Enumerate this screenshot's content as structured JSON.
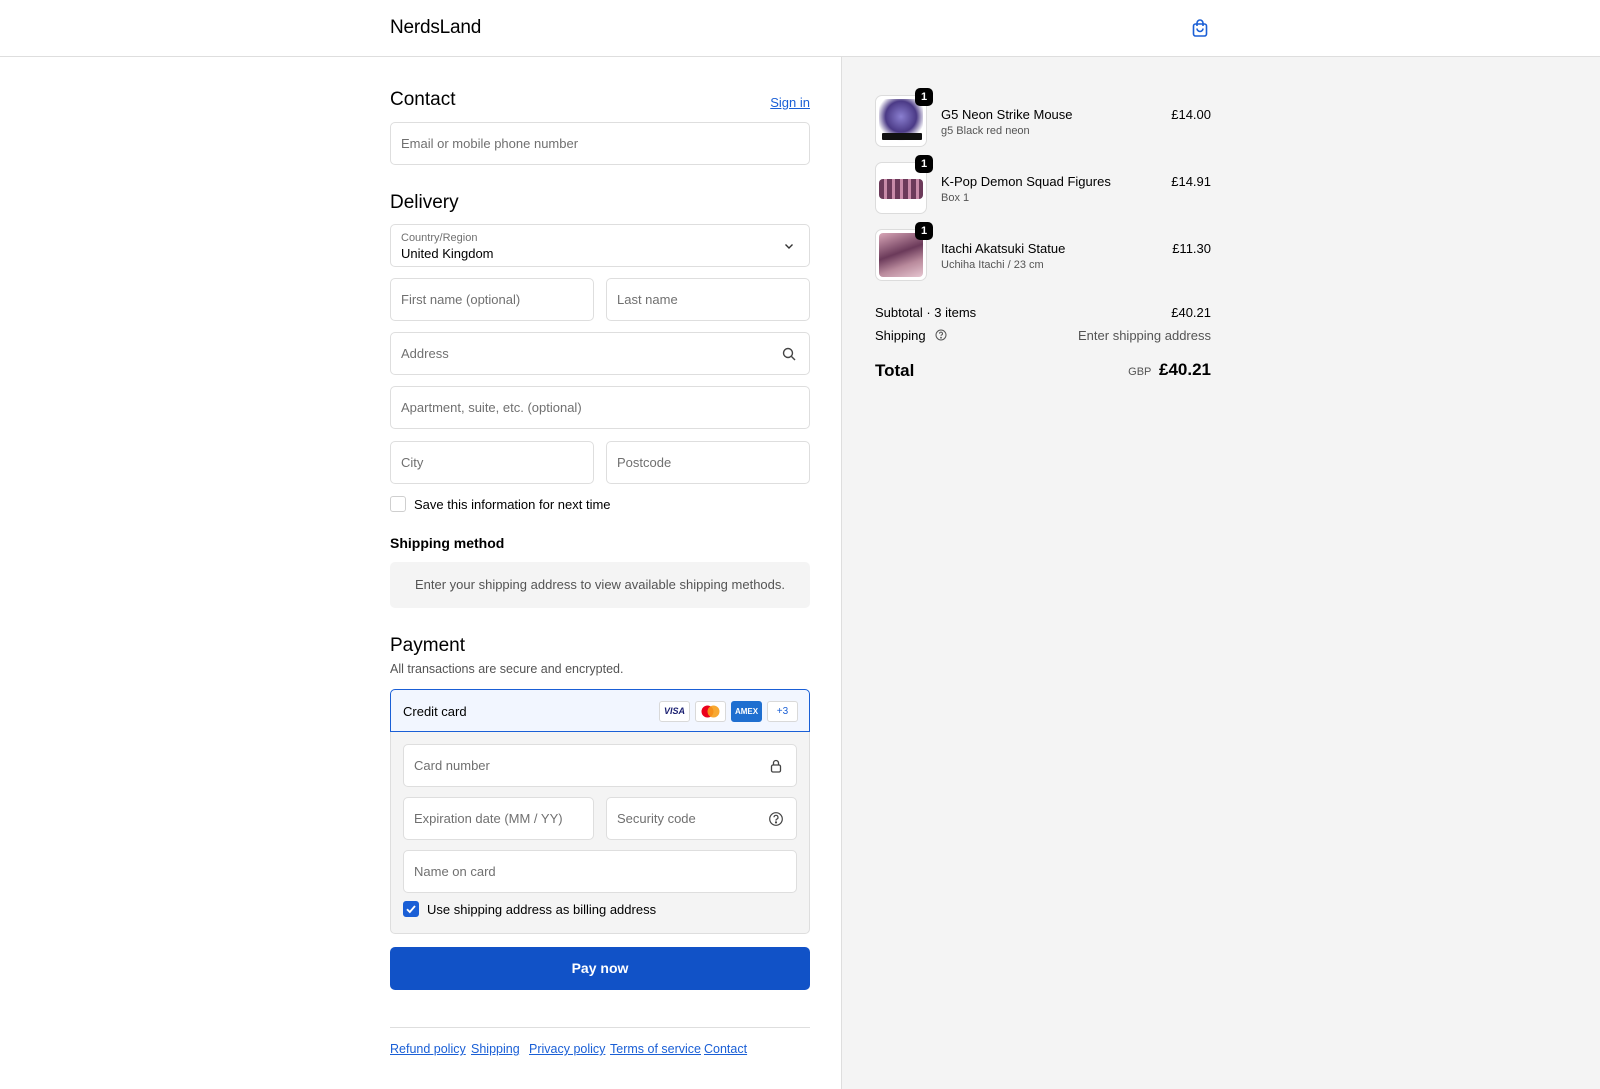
{
  "header": {
    "brand": "NerdsLand",
    "cart_icon": "shopping-bag-icon"
  },
  "contact": {
    "title": "Contact",
    "sign_in": "Sign in",
    "email_placeholder": "Email or mobile phone number"
  },
  "delivery": {
    "title": "Delivery",
    "country_label": "Country/Region",
    "country_value": "United Kingdom",
    "first_name_placeholder": "First name (optional)",
    "last_name_placeholder": "Last name",
    "address_placeholder": "Address",
    "apartment_placeholder": "Apartment, suite, etc. (optional)",
    "city_placeholder": "City",
    "postcode_placeholder": "Postcode",
    "save_info_label": "Save this information for next time",
    "save_info_checked": false
  },
  "shipping_method": {
    "title": "Shipping method",
    "message": "Enter your shipping address to view available shipping methods."
  },
  "payment": {
    "title": "Payment",
    "subtitle": "All transactions are secure and encrypted.",
    "method_label": "Credit card",
    "card_logos": [
      "VISA",
      "Mastercard",
      "AMEX",
      "+3"
    ],
    "card_number_placeholder": "Card number",
    "expiry_placeholder": "Expiration date (MM / YY)",
    "security_placeholder": "Security code",
    "name_placeholder": "Name on card",
    "billing_same_label": "Use shipping address as billing address",
    "billing_same_checked": true,
    "pay_button": "Pay now"
  },
  "footer": {
    "links": [
      "Refund policy",
      "Shipping",
      "Privacy policy",
      "Terms of service",
      "Contact"
    ]
  },
  "order": {
    "items": [
      {
        "name": "G5 Neon Strike Mouse",
        "variant": "g5 Black red neon",
        "price": "£14.00",
        "qty": "1",
        "thumb_color": "#5b4a8a"
      },
      {
        "name": "K-Pop Demon Squad Figures",
        "variant": "Box 1",
        "price": "£14.91",
        "qty": "1",
        "thumb_color": "#b46c8a"
      },
      {
        "name": "Itachi Akatsuki Statue",
        "variant": "Uchiha Itachi / 23 cm",
        "price": "£11.30",
        "qty": "1",
        "thumb_color": "#8a5a7a"
      }
    ],
    "subtotal_label": "Subtotal · 3 items",
    "subtotal_value": "£40.21",
    "shipping_label": "Shipping",
    "shipping_value": "Enter shipping address",
    "total_label": "Total",
    "currency": "GBP",
    "total_value": "£40.21"
  },
  "colors": {
    "accent": "#1152c7",
    "link": "#1a5fd6",
    "panel_bg": "#f4f4f4"
  }
}
